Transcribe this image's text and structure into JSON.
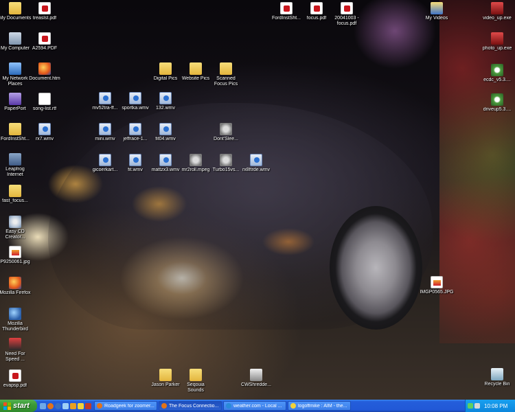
{
  "desktop": {
    "icons": [
      {
        "label": "My Documents",
        "icon": "my-documents-icon"
      },
      {
        "label": "treaslst.pdf",
        "icon": "pdf-file-icon"
      },
      {
        "label": "My Computer",
        "icon": "my-computer-icon"
      },
      {
        "label": "A2594.PDF",
        "icon": "pdf-file-icon"
      },
      {
        "label": "My Network Places",
        "icon": "network-places-icon"
      },
      {
        "label": "Document.htm",
        "icon": "firefox-document-icon"
      },
      {
        "label": "PaperPort",
        "icon": "paperport-icon"
      },
      {
        "label": "song-list.rtf",
        "icon": "rtf-document-icon"
      },
      {
        "label": "FordInstSht...",
        "icon": "folder-icon"
      },
      {
        "label": "rx7.wmv",
        "icon": "wmv-video-icon"
      },
      {
        "label": "Leapfrog Internet",
        "icon": "leapfrog-app-icon"
      },
      {
        "label": "fast_focus...",
        "icon": "folder-icon"
      },
      {
        "label": "Easy CD Creator...",
        "icon": "cd-creator-icon"
      },
      {
        "label": "P9250061.jpg",
        "icon": "jpg-image-icon"
      },
      {
        "label": "Mozilla Firefox",
        "icon": "firefox-icon"
      },
      {
        "label": "Mozilla Thunderbird",
        "icon": "thunderbird-icon"
      },
      {
        "label": "Need For Speed ...",
        "icon": "need-for-speed-icon"
      },
      {
        "label": "evapsp.pdf",
        "icon": "pdf-file-icon"
      },
      {
        "label": "mv52tra-ff...",
        "icon": "wmv-video-icon"
      },
      {
        "label": "sportka.wmv",
        "icon": "wmv-video-icon"
      },
      {
        "label": "132.wmv",
        "icon": "wmv-video-icon"
      },
      {
        "label": "mini.wmv",
        "icon": "wmv-video-icon"
      },
      {
        "label": "jeffrace-1...",
        "icon": "wmv-video-icon"
      },
      {
        "label": "fit04.wmv",
        "icon": "wmv-video-icon"
      },
      {
        "label": "Dont'Slee...",
        "icon": "mpeg-video-icon"
      },
      {
        "label": "gicoerkart...",
        "icon": "wmv-video-icon"
      },
      {
        "label": "fit.wmv",
        "icon": "wmv-video-icon"
      },
      {
        "label": "mattzx3.wmv",
        "icon": "wmv-video-icon"
      },
      {
        "label": "mr2roll.mpeg",
        "icon": "mpeg-video-icon"
      },
      {
        "label": "Turbo15vs...",
        "icon": "mpeg-video-icon"
      },
      {
        "label": "rx8ftrde.wmv",
        "icon": "wmv-video-icon"
      },
      {
        "label": "Digital Pics",
        "icon": "folder-icon"
      },
      {
        "label": "Website Pics",
        "icon": "folder-icon"
      },
      {
        "label": "Scanned Focus Pics",
        "icon": "folder-icon"
      },
      {
        "label": "FordInstSht...",
        "icon": "pdf-file-icon"
      },
      {
        "label": "focus.pdf",
        "icon": "pdf-file-icon"
      },
      {
        "label": "20041003 - focus.pdf",
        "icon": "pdf-file-icon"
      },
      {
        "label": "My Videos",
        "icon": "my-videos-icon"
      },
      {
        "label": "video_up.exe",
        "icon": "exe-installer-icon"
      },
      {
        "label": "photo_up.exe",
        "icon": "exe-installer-icon"
      },
      {
        "label": "ecdc_v5.3....",
        "icon": "setup-gear-icon"
      },
      {
        "label": "driveup5.3....",
        "icon": "setup-gear-icon"
      },
      {
        "label": "IMGP0565.JPG",
        "icon": "jpg-image-icon"
      },
      {
        "label": "Jason Parker",
        "icon": "folder-icon"
      },
      {
        "label": "Seqouia Sounds",
        "icon": "folder-icon"
      },
      {
        "label": "CWShredde...",
        "icon": "shredder-app-icon"
      },
      {
        "label": "Recycle Bin",
        "icon": "recycle-bin-icon"
      }
    ]
  },
  "taskbar": {
    "start_label": "start",
    "quick_launch": [
      "show-desktop-icon",
      "firefox-quicklaunch-icon",
      "thunderbird-quicklaunch-icon",
      "explorer-quicklaunch-icon",
      "media-player-quicklaunch-icon",
      "aim-quicklaunch-icon",
      "winamp-quicklaunch-icon"
    ],
    "tasks": [
      {
        "label": "Roadgeek for zoomer...",
        "icon": "firefox-task-icon",
        "active": false
      },
      {
        "label": "The Focus Connectio...",
        "icon": "firefox-task-icon",
        "active": true
      },
      {
        "label": "weather.com - Local ...",
        "icon": "browser-task-icon",
        "active": false
      },
      {
        "label": "logoffmike : AIM - the...",
        "icon": "aim-task-icon",
        "active": false
      }
    ],
    "tray_icons": [
      "tray-network-icon",
      "tray-volume-icon",
      "tray-antivirus-icon",
      "tray-security-icon"
    ],
    "clock": "10:08 PM"
  },
  "colors": {
    "taskbar": "#245edb",
    "start_button": "#3c9a38",
    "tray": "#0c86dc"
  }
}
